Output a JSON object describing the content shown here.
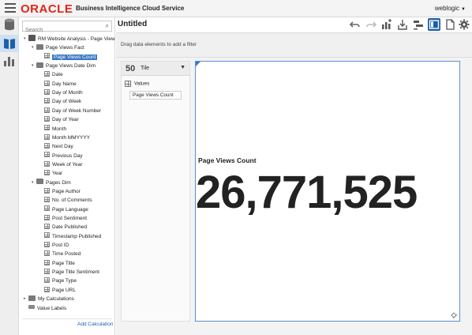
{
  "header": {
    "logo_text": "ORACLE",
    "product_name": "Business Intelligence Cloud Service",
    "user_name": "weblogic",
    "accent_color": "#e1261c"
  },
  "left_rail": {
    "items": [
      {
        "icon": "database-icon"
      },
      {
        "icon": "book-icon"
      },
      {
        "icon": "bar-chart-icon"
      }
    ]
  },
  "data_panel": {
    "search_placeholder": "Search",
    "add_calculation_label": "Add Calculation",
    "tree": [
      {
        "label": "RM Website Analysis - Page View",
        "level": 0,
        "twisty": "▾",
        "icon": "db"
      },
      {
        "label": "Page Views Fact",
        "level": 1,
        "twisty": "▾",
        "icon": "folder"
      },
      {
        "label": "Page Views Count",
        "level": 2,
        "twisty": "",
        "icon": "grid",
        "selected": true
      },
      {
        "label": "Page Views Date Dim",
        "level": 1,
        "twisty": "▾",
        "icon": "folder"
      },
      {
        "label": "Date",
        "level": 2,
        "twisty": "",
        "icon": "grid"
      },
      {
        "label": "Day Name",
        "level": 2,
        "twisty": "",
        "icon": "grid"
      },
      {
        "label": "Day of Month",
        "level": 2,
        "twisty": "",
        "icon": "grid"
      },
      {
        "label": "Day of Week",
        "level": 2,
        "twisty": "",
        "icon": "grid"
      },
      {
        "label": "Day of Week Number",
        "level": 2,
        "twisty": "",
        "icon": "grid"
      },
      {
        "label": "Day of Year",
        "level": 2,
        "twisty": "",
        "icon": "grid"
      },
      {
        "label": "Month",
        "level": 2,
        "twisty": "",
        "icon": "grid"
      },
      {
        "label": "Month MMYYYY",
        "level": 2,
        "twisty": "",
        "icon": "grid"
      },
      {
        "label": "Next Day",
        "level": 2,
        "twisty": "",
        "icon": "grid"
      },
      {
        "label": "Previous Day",
        "level": 2,
        "twisty": "",
        "icon": "grid"
      },
      {
        "label": "Week of Year",
        "level": 2,
        "twisty": "",
        "icon": "grid"
      },
      {
        "label": "Year",
        "level": 2,
        "twisty": "",
        "icon": "grid"
      },
      {
        "label": "Pages Dim",
        "level": 1,
        "twisty": "▾",
        "icon": "folder"
      },
      {
        "label": "Page Author",
        "level": 2,
        "twisty": "",
        "icon": "grid"
      },
      {
        "label": "No. of Comments",
        "level": 2,
        "twisty": "",
        "icon": "grid"
      },
      {
        "label": "Page Language",
        "level": 2,
        "twisty": "",
        "icon": "grid"
      },
      {
        "label": "Post Sentiment",
        "level": 2,
        "twisty": "",
        "icon": "grid"
      },
      {
        "label": "Date Published",
        "level": 2,
        "twisty": "",
        "icon": "grid"
      },
      {
        "label": "Timestamp Published",
        "level": 2,
        "twisty": "",
        "icon": "grid"
      },
      {
        "label": "Post ID",
        "level": 2,
        "twisty": "",
        "icon": "grid"
      },
      {
        "label": "Time Posted",
        "level": 2,
        "twisty": "",
        "icon": "grid"
      },
      {
        "label": "Page Title",
        "level": 2,
        "twisty": "",
        "icon": "grid"
      },
      {
        "label": "Page Title Sentiment",
        "level": 2,
        "twisty": "",
        "icon": "grid"
      },
      {
        "label": "Page Type",
        "level": 2,
        "twisty": "",
        "icon": "grid"
      },
      {
        "label": "Page URL",
        "level": 2,
        "twisty": "",
        "icon": "grid"
      },
      {
        "label": "My Calculations",
        "level": 0,
        "twisty": "▸",
        "icon": "folder"
      },
      {
        "label": "Value Labels",
        "level": 0,
        "twisty": "",
        "icon": "label"
      }
    ]
  },
  "main": {
    "title": "Untitled",
    "toolbar": [
      {
        "icon": "undo-icon"
      },
      {
        "icon": "redo-icon"
      },
      {
        "icon": "add-chart-icon"
      },
      {
        "icon": "export-icon"
      },
      {
        "icon": "layout-icon"
      },
      {
        "icon": "panel-toggle-icon",
        "active": true
      },
      {
        "icon": "page-icon"
      },
      {
        "icon": "gear-icon"
      }
    ],
    "filter_hint": "Drag data elements to add a filter"
  },
  "grammar": {
    "viz_type_icon_text": "50",
    "viz_type_label": "Tile",
    "section_label": "Values",
    "value_item": "Page Views Count"
  },
  "tile": {
    "label": "Page Views Count",
    "value": "26,771,525"
  }
}
